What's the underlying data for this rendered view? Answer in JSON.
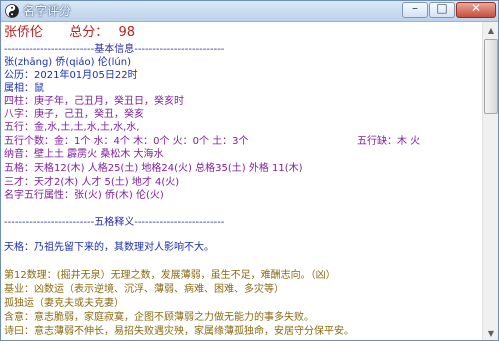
{
  "window": {
    "title": "名字评分"
  },
  "score": {
    "name": "张侨伦",
    "label": "总分：",
    "value": "98"
  },
  "basic": {
    "header": "-------------------------基本信息-------------------------",
    "pinyin": "张(zhāng)  侨(qiáo)  伦(lún)",
    "solar": "公历：2021年01月05日22时",
    "zodiac": "属相：鼠",
    "pillars": "四柱：庚子年，己丑月，癸丑日，癸亥时",
    "bazi": "八字：庚子，己丑，癸丑，癸亥",
    "wuxing": "五行：金,水,土,土,水,土,水,水,",
    "count": "五行个数：金：1个  水：4个  木：0个  火：0个  土：3个",
    "lack": "五行缺：木 火",
    "nayin": "纳音：壁上土  霹雳火  桑松木  大海水",
    "tiange": "五格：天格12(木)  人格25(土)  地格24(火)  总格35(土)  外格 11(木)",
    "sancai": "三才：天才2(木)   人才 5(土)   地才 4(火)",
    "attr": "名字五行属性：张(火)  侨(木)  伦(火)"
  },
  "wuge": {
    "header": "-------------------------五格释义-------------------------",
    "tiange_explain": "天格：乃祖先留下来的，其数理对人影响不大。",
    "number": "第12数理：(掘井无泉）无理之数，发展薄弱，虽生不足，难酬志向。（凶）",
    "basis": "基业：凶数运（表示逆境、沉浮、薄弱、病难、困难、多灾等）",
    "lonely": "孤独运（妻克夫或夫克妻）",
    "meaning": "含意：意志脆弱，家庭寂寞，企图不顾薄弱之力做无能力的事多失败。",
    "poem": "诗曰：意志薄弱不伸长，易招失败遇灾殃，家属缘薄孤独命，安居守分保平安。"
  }
}
